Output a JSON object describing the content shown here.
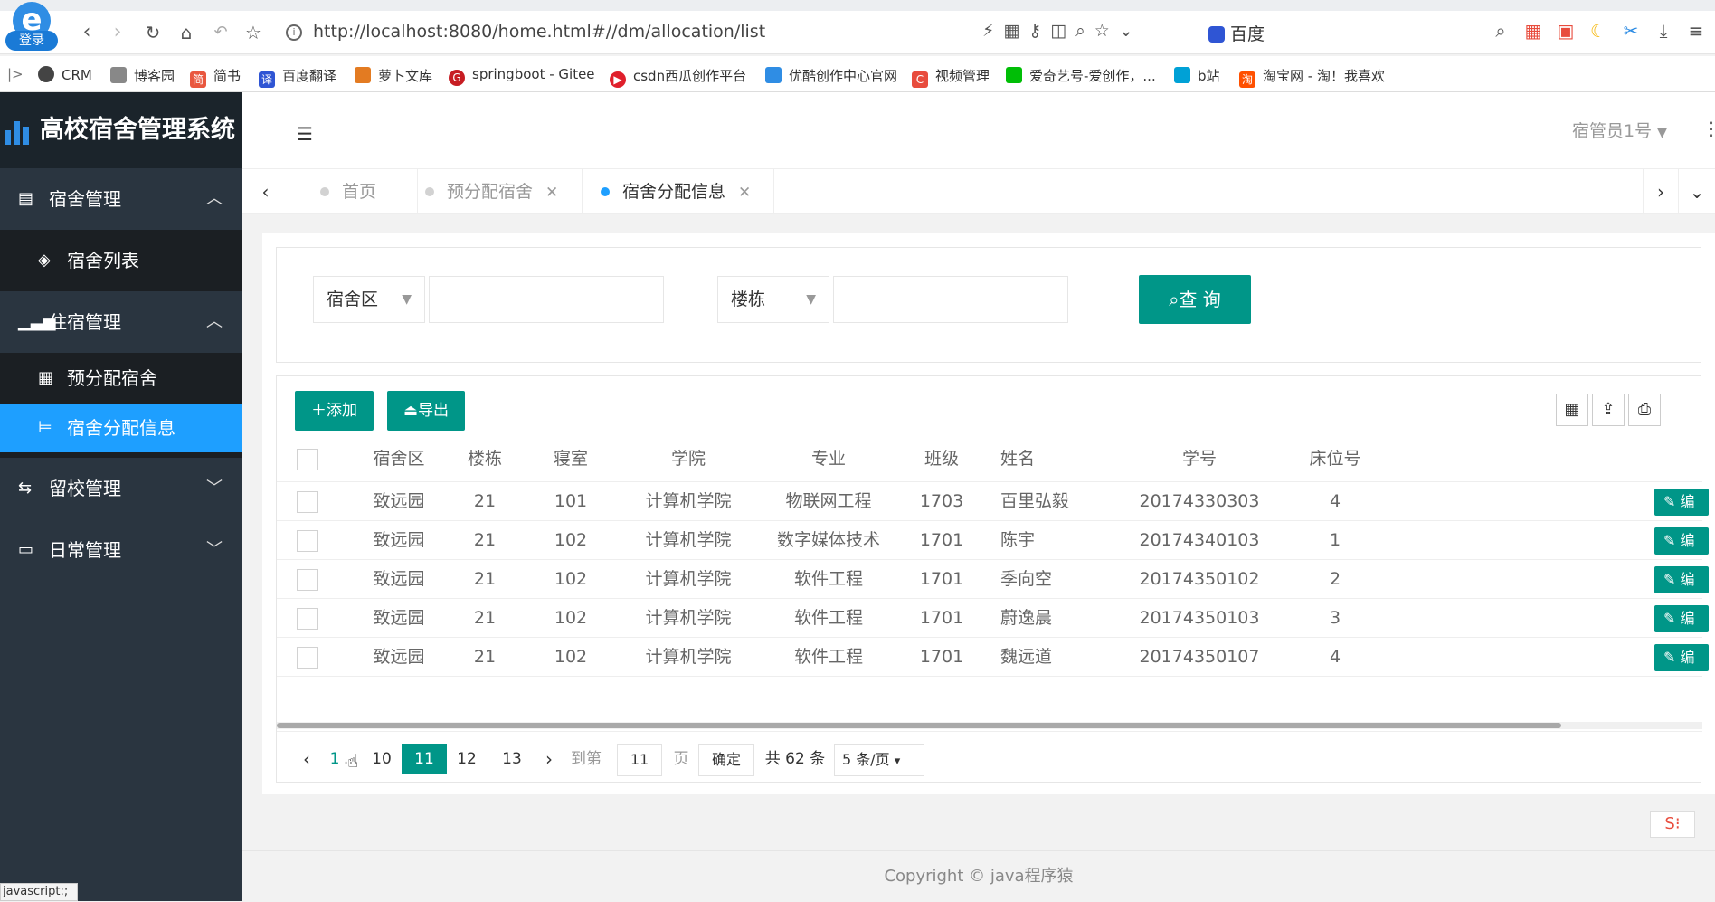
{
  "browser": {
    "login_label": "登录",
    "url": "http://localhost:8080/home.html#//dm/allocation/list",
    "search_engine": "百度",
    "bookmarks": [
      "CRM",
      "博客园",
      "简书",
      "百度翻译",
      "萝卜文库",
      "springboot - Gitee",
      "csdn西瓜创作平台",
      "优酷创作中心官网",
      "视频管理",
      "爱奇艺号-爱创作，...",
      "b站",
      "淘宝网 - 淘！我喜欢"
    ],
    "status_text": "javascript:;"
  },
  "sidebar": {
    "brand": "高校宿舍管理系统",
    "groups": [
      {
        "label": "宿舍管理",
        "items": [
          "宿舍列表"
        ]
      },
      {
        "label": "住宿管理",
        "items": [
          "预分配宿舍",
          "宿舍分配信息"
        ]
      },
      {
        "label": "留校管理"
      },
      {
        "label": "日常管理"
      }
    ]
  },
  "header": {
    "user": "宿管员1号"
  },
  "tabs": [
    "首页",
    "预分配宿舍",
    "宿舍分配信息"
  ],
  "search": {
    "area_select": "宿舍区",
    "building_select": "楼栋",
    "query_button": "查 询"
  },
  "toolbar": {
    "add": "添加",
    "export": "导出"
  },
  "table": {
    "columns": [
      "宿舍区",
      "楼栋",
      "寝室",
      "学院",
      "专业",
      "班级",
      "姓名",
      "学号",
      "床位号"
    ],
    "edit_label": "编",
    "rows": [
      [
        "致远园",
        "21",
        "101",
        "计算机学院",
        "物联网工程",
        "1703",
        "百里弘毅",
        "20174330303",
        "4"
      ],
      [
        "致远园",
        "21",
        "102",
        "计算机学院",
        "数字媒体技术",
        "1701",
        "陈宇",
        "20174340103",
        "1"
      ],
      [
        "致远园",
        "21",
        "102",
        "计算机学院",
        "软件工程",
        "1701",
        "季向空",
        "20174350102",
        "2"
      ],
      [
        "致远园",
        "21",
        "102",
        "计算机学院",
        "软件工程",
        "1701",
        "蔚逸晨",
        "20174350103",
        "3"
      ],
      [
        "致远园",
        "21",
        "102",
        "计算机学院",
        "软件工程",
        "1701",
        "魏远道",
        "20174350107",
        "4"
      ]
    ]
  },
  "pager": {
    "first": "1",
    "ellipsis": "...",
    "pages": [
      "10",
      "11",
      "12",
      "13"
    ],
    "current": "11",
    "goto_label": "到第",
    "goto_value": "11",
    "page_unit": "页",
    "confirm": "确定",
    "total": "共 62 条",
    "page_size": "5 条/页"
  },
  "footer": {
    "copyright": "Copyright © java程序猿"
  }
}
